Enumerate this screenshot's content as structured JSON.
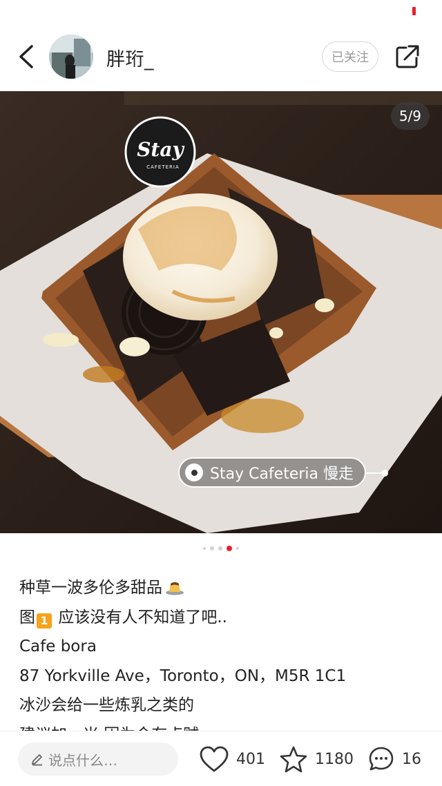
{
  "header": {
    "username": "胖珩_",
    "follow_label": "已关注"
  },
  "photo": {
    "counter": "5/9",
    "location_tag": "Stay Cafeteria 慢走",
    "logo_text": "Stay",
    "logo_subtext": "CAFETERIA"
  },
  "carousel": {
    "total_dots": 5,
    "active_index": 3
  },
  "post": {
    "line1": "种草一波多伦多甜品",
    "line2_prefix": "图",
    "line2_badge": "1",
    "line2_text": "应该没有人不知道了吧..",
    "line3": "Cafe bora",
    "line4": "87 Yorkville Ave，Toronto，ON，M5R 1C1",
    "line5": "冰沙会给一些炼乳之类的",
    "line6": "建议加一米 因为会有点贼"
  },
  "bottom_bar": {
    "comment_placeholder": "说点什么…",
    "likes": "401",
    "collects": "1180",
    "comments": "16"
  },
  "icons": {
    "back": "chevron-left-icon",
    "share": "share-icon",
    "edit": "pencil-icon",
    "like": "heart-icon",
    "collect": "star-icon",
    "comment": "comment-bubble-icon",
    "location": "location-pin-icon"
  },
  "colors": {
    "accent": "#e8202a",
    "follow_border": "#d6d6d6",
    "input_bg": "#f3f3f3"
  }
}
